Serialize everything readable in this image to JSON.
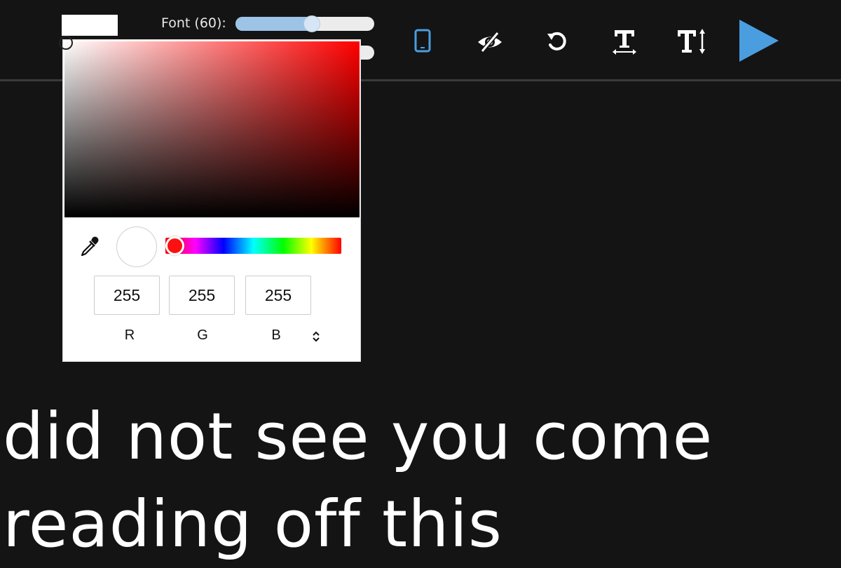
{
  "toolbar": {
    "font_label": "Font (60):",
    "font_size": 60,
    "font_slider_level": 0.55,
    "swatch_color": "#ffffff",
    "accent_color": "#4a9ee0",
    "icons": [
      "tablet-icon",
      "eye-slash-icon",
      "reset-icon",
      "text-width-icon",
      "text-height-icon",
      "play-icon"
    ]
  },
  "color_picker": {
    "r": "255",
    "g": "255",
    "b": "255",
    "r_label": "R",
    "g_label": "G",
    "b_label": "B",
    "hue_color": "#ff0000",
    "selected_color": "#ffffff"
  },
  "prompter": {
    "line1": "did not see you come",
    "line2": "reading off this"
  }
}
